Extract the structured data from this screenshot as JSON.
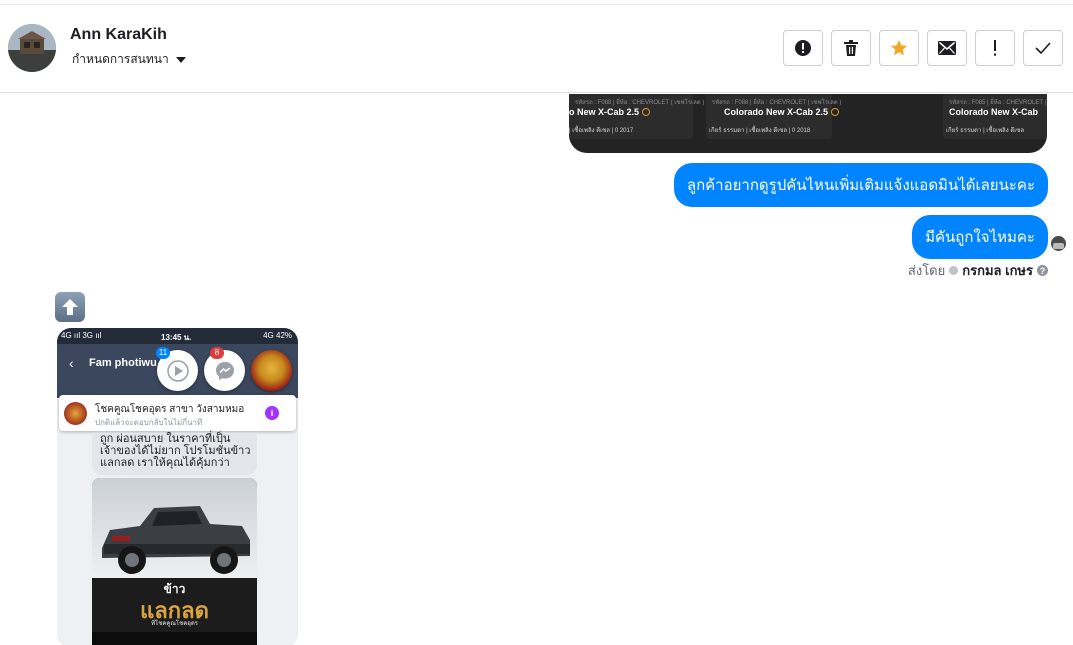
{
  "header": {
    "contact_name": "Ann KaraKih",
    "assign_label": "กำหนดการสนทนา",
    "actions": [
      "spam-icon",
      "trash-icon",
      "star-icon",
      "mail-icon",
      "exclamation-icon",
      "check-icon"
    ],
    "star_color": "#f5a623"
  },
  "carousel": {
    "cards": [
      {
        "spec": "รหัสรถ : F088  |  ยี่ห้อ : CHEVROLET ( เชฟโรเลต )",
        "title": "o New X-Cab 2.5",
        "meta": "|  เชื้อเพลิง ดีเซล  |  0 2017"
      },
      {
        "spec": "รหัสรถ : F088  |  ยี่ห้อ : CHEVROLET ( เชฟโรเลต )",
        "title": "Colorado New X-Cab 2.5",
        "meta": "เกียร์ ธรรมดา  |  เชื้อเพลิง ดีเซล  |  0 2018"
      },
      {
        "spec": "รหัสรถ : F085  |  ยี่ห้อ : CHEVROLET ( เชฟโรเลต )",
        "title": "Colorado New X-Cab",
        "meta": "เกียร์ ธรรมดา  |  เชื้อเพลิง ดีเซล"
      }
    ]
  },
  "messages": [
    {
      "text": "ลูกค้าอยากดูรูปคันไหนเพิ่มเติมแจ้งแอดมินได้เลยนะคะ"
    },
    {
      "text": "มีคันถูกใจไหมคะ"
    }
  ],
  "sent_by": {
    "prefix": "ส่งโดย",
    "name": "กรกมล เกษร",
    "help": "?"
  },
  "attachment": {
    "status": {
      "left": "4G ııl 3G ııl",
      "time": "13:45 น.",
      "right": "4G 42%"
    },
    "chat_name": "Fam photiwu",
    "badge_play": "11",
    "badge_messenger": "8",
    "popup_title": "โชคคูณโชคอุดร สาขา วังสามหมอ",
    "popup_subtitle": "ปกติแล้วจะตอบกลับในไม่กี่นาที",
    "message_lines": [
      "ถูก ผ่อนสบาย ในราคาที่เป็น",
      "เจ้าของได้ไม่ยาก โปรโมชั่นข้าว",
      "แลกลด เราให้คุณได้คุ้มกว่า"
    ],
    "promo_top": "ข้าว",
    "promo_title": "แลกลด",
    "promo_small": "ที่โชคคูณโชคอุดร"
  },
  "colors": {
    "accent": "#0084ff",
    "bubble_text": "#ffffff"
  }
}
